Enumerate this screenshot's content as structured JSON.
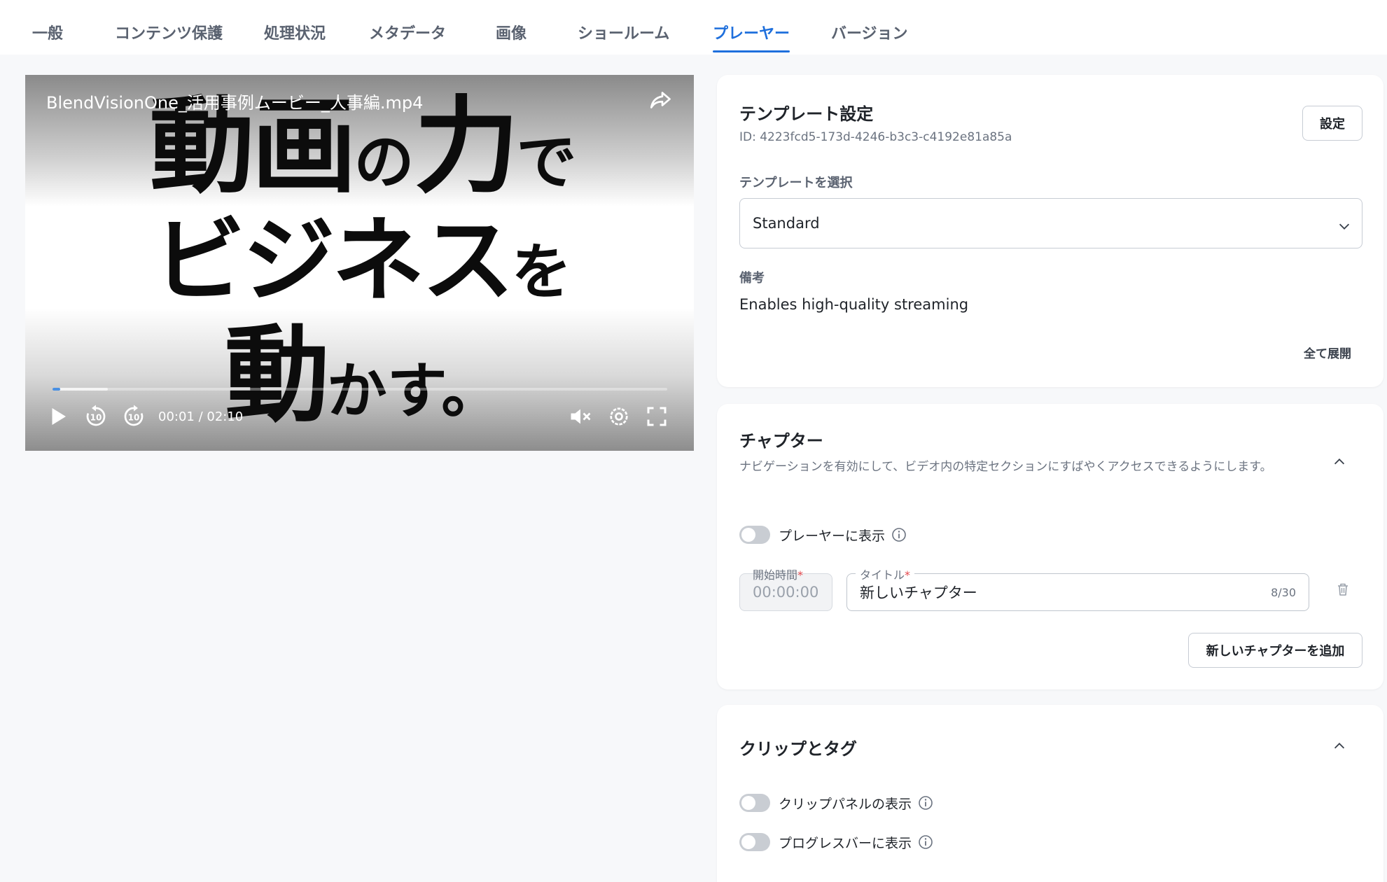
{
  "tabs": [
    {
      "label": "一般"
    },
    {
      "label": "コンテンツ保護"
    },
    {
      "label": "処理状況"
    },
    {
      "label": "メタデータ"
    },
    {
      "label": "画像"
    },
    {
      "label": "ショールーム"
    },
    {
      "label": "プレーヤー",
      "active": true
    },
    {
      "label": "バージョン"
    }
  ],
  "player": {
    "video_title": "BlendVisionOne_活用事例ムービー_人事編.mp4",
    "poster_text": {
      "line1_a": "動画",
      "line1_b": "の",
      "line1_c": "力",
      "line1_d": "で",
      "line2_a": "ビジネス",
      "line2_b": "を",
      "line3_a": "動",
      "line3_b": "かす。"
    },
    "current_time": "00:01",
    "duration": "02:10",
    "time_separator": " / ",
    "progress_played": 0.012,
    "progress_buffered": 0.09,
    "icons": [
      "share-icon",
      "play-icon",
      "rewind-10-icon",
      "forward-10-icon",
      "mute-icon",
      "settings-gear-icon",
      "fullscreen-icon"
    ],
    "control_color": "#ffffff",
    "progress_color": "#4a90e2"
  },
  "template": {
    "title": "テンプレート設定",
    "id_text": "ID: 4223fcd5-173d-4246-b3c3-c4192e81a85a",
    "settings_button": "設定",
    "select_label": "テンプレートを選択",
    "selected": "Standard",
    "notes_label": "備考",
    "notes_value": "Enables high-quality streaming",
    "expand_all": "全て展開"
  },
  "chapters": {
    "title": "チャプター",
    "description": "ナビゲーションを有効にして、ビデオ内の特定セクションにすばやくアクセスできるようにします。",
    "show_in_player": "プレーヤーに表示",
    "show_in_player_on": false,
    "start_time_label": "開始時間",
    "start_time_placeholder": "00:00:00",
    "title_label": "タイトル",
    "title_value": "新しいチャプター",
    "char_count": "8/30",
    "required_mark": "*",
    "add_button": "新しいチャプターを追加"
  },
  "clips": {
    "title": "クリップとタグ",
    "show_clip_panel": "クリップパネルの表示",
    "show_clip_panel_on": false,
    "show_on_progress_bar": "プログレスバーに表示",
    "show_on_progress_bar_on": false
  },
  "colors": {
    "accent": "#1e6fdc",
    "required": "#e5484d",
    "toggle_off": "#c9cdd3"
  }
}
